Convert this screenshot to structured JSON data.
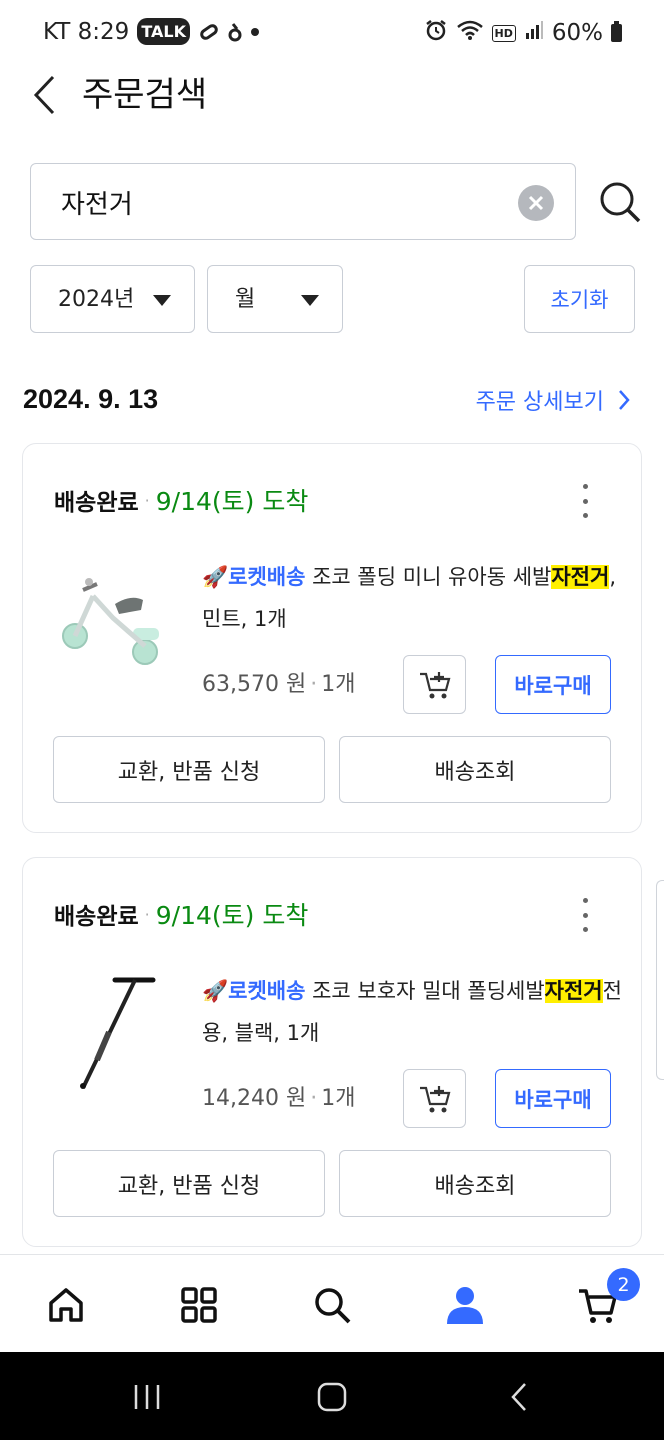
{
  "status_bar": {
    "carrier_time": "KT 8:29",
    "talk_badge": "TALK",
    "battery": "60%",
    "hd_label": "HD"
  },
  "header": {
    "title": "주문검색",
    "back_icon": "chevron-left-icon"
  },
  "search": {
    "value": "자전거",
    "clear_icon": "close-circle-icon",
    "search_icon": "magnifier-icon"
  },
  "filters": {
    "year": "2024년",
    "month": "월",
    "reset": "초기화"
  },
  "order": {
    "date": "2024. 9. 13",
    "detail_link": "주문 상세보기"
  },
  "items": [
    {
      "status": "배송완료",
      "arrival": "9/14(토) 도착",
      "rocket": "🚀로켓배송",
      "name_before": " 조코 폴딩 미니 유아동 세발",
      "name_highlight": "자전거",
      "name_after": ", 민트, 1개",
      "price": "63,570 원",
      "qty": "1개",
      "buy": "바로구매",
      "return": "교환, 반품 신청",
      "track": "배송조회"
    },
    {
      "status": "배송완료",
      "arrival": "9/14(토) 도착",
      "rocket": "🚀로켓배송",
      "name_before": " 조코 보호자 밀대 폴딩세발",
      "name_highlight": "자전거",
      "name_after": "전용, 블랙, 1개",
      "price": "14,240 원",
      "qty": "1개",
      "buy": "바로구매",
      "return": "교환, 반품 신청",
      "track": "배송조회"
    }
  ],
  "bottom_nav": {
    "items": [
      "home-icon",
      "category-grid-icon",
      "search-icon",
      "my-account-icon",
      "cart-icon"
    ],
    "cart_count": "2"
  },
  "colors": {
    "accent": "#346aff",
    "arrival_green": "#0a8a12",
    "highlight": "#ffef00"
  }
}
